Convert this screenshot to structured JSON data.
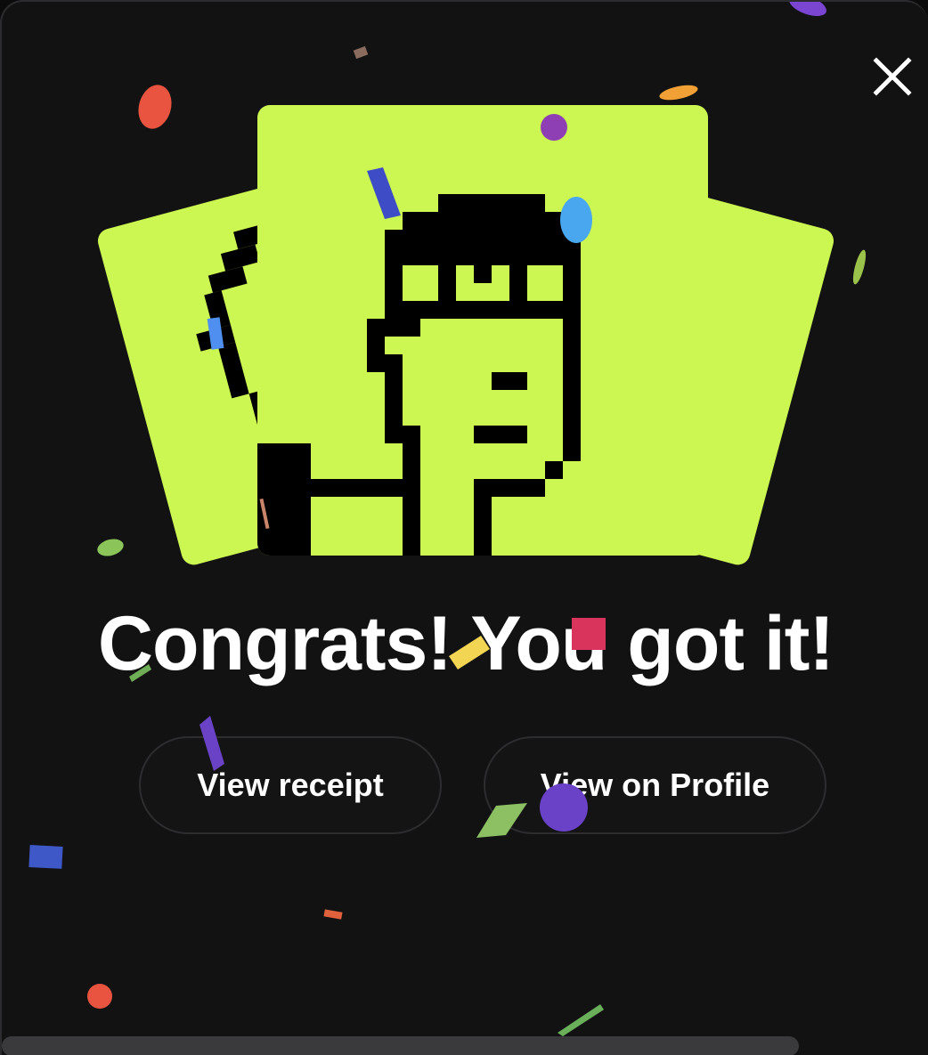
{
  "headline": "Congrats! You got it!",
  "buttons": {
    "receipt": "View receipt",
    "profile": "View on Profile"
  },
  "colors": {
    "background": "#121212",
    "card": "#ccf752",
    "pixel": "#000000",
    "text": "#ffffff",
    "button_border": "#2d2d30"
  },
  "icons": {
    "close": "close-icon"
  }
}
